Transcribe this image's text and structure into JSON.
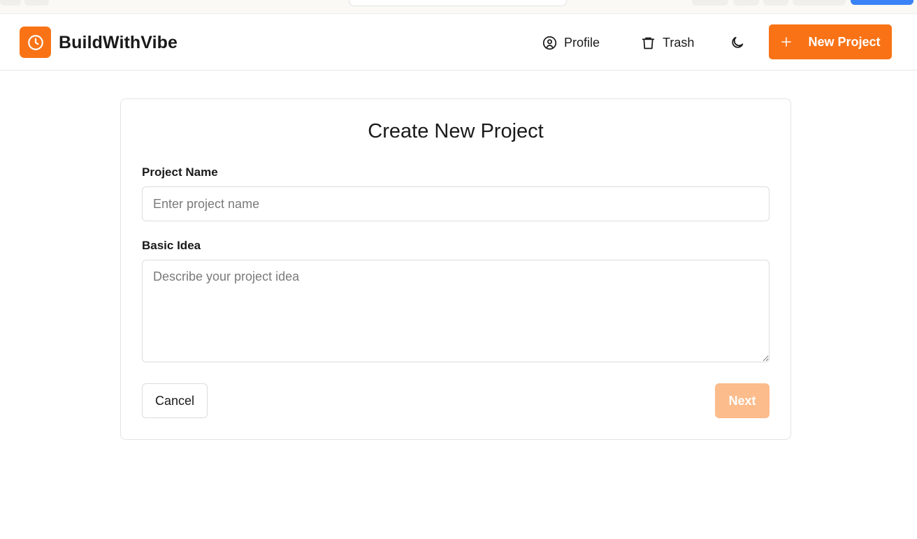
{
  "header": {
    "brand": "BuildWithVibe",
    "nav": {
      "profile_label": "Profile",
      "trash_label": "Trash"
    },
    "new_project_label": "New Project",
    "icons": {
      "logo": "clock-icon",
      "profile": "user-circle-icon",
      "trash": "trash-icon",
      "theme": "moon-icon",
      "new_project": "plus-icon"
    }
  },
  "form": {
    "title": "Create New Project",
    "project_name": {
      "label": "Project Name",
      "placeholder": "Enter project name",
      "value": ""
    },
    "basic_idea": {
      "label": "Basic Idea",
      "placeholder": "Describe your project idea",
      "value": ""
    },
    "cancel_label": "Cancel",
    "next_label": "Next"
  },
  "colors": {
    "accent": "#f97316",
    "accent_disabled": "#fcbc8c",
    "border": "#dcdcdc"
  }
}
